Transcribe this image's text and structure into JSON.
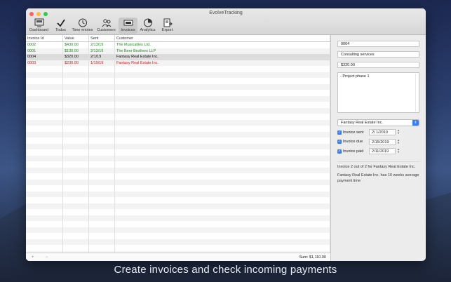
{
  "window": {
    "title": "EvolveTracking"
  },
  "toolbar": [
    {
      "label": "Dashboard",
      "icon": "dashboard-icon"
    },
    {
      "label": "Todos",
      "icon": "checkmark-icon"
    },
    {
      "label": "Time entries",
      "icon": "clock-icon"
    },
    {
      "label": "Customers",
      "icon": "people-icon"
    },
    {
      "label": "Invoices",
      "icon": "invoice-icon",
      "active": true
    },
    {
      "label": "Analytics",
      "icon": "analytics-icon"
    },
    {
      "label": "Export",
      "icon": "export-icon"
    }
  ],
  "table": {
    "columns": [
      "Invoice Id",
      "Value",
      "Sent",
      "Customer"
    ],
    "rows": [
      {
        "id": "0002",
        "value": "$430.00",
        "sent": "2/13/19",
        "customer": "The Musicallies Ltd.",
        "status": "green"
      },
      {
        "id": "0001",
        "value": "$130.00",
        "sent": "2/13/19",
        "customer": "The Beer Brothers LLP",
        "status": "green"
      },
      {
        "id": "0004",
        "value": "$320.00",
        "sent": "2/1/19",
        "customer": "Fantasy Real Estate Inc.",
        "status": "selected"
      },
      {
        "id": "0003",
        "value": "$230.00",
        "sent": "1/19/19",
        "customer": "Fantasy Real Estate Inc.",
        "status": "red"
      }
    ],
    "footer": {
      "add": "+",
      "remove": "−",
      "sum": "Sum: $1,110.00"
    }
  },
  "detail": {
    "invoice_id": "0004",
    "description": "Consulting services",
    "amount": "$320.00",
    "notes": "- Project phase 1",
    "customer": "Fantasy Real Estate Inc.",
    "sent": {
      "label": "Invoice sent",
      "date": "2/  1/2019"
    },
    "due": {
      "label": "Invoice due",
      "date": "2/15/2019"
    },
    "paid": {
      "label": "Invoice paid",
      "date": "2/11/2019"
    },
    "info1": "Invoice 2 out of 2 for Fantasy Real Estate Inc.",
    "info2": "Fantasy Real Estate Inc. has 10 weeks average payment time"
  },
  "caption": "Create invoices and check incoming payments",
  "colors": {
    "accent": "#3a7df2",
    "paid_green": "#1e8e1e",
    "overdue_red": "#d62020"
  }
}
